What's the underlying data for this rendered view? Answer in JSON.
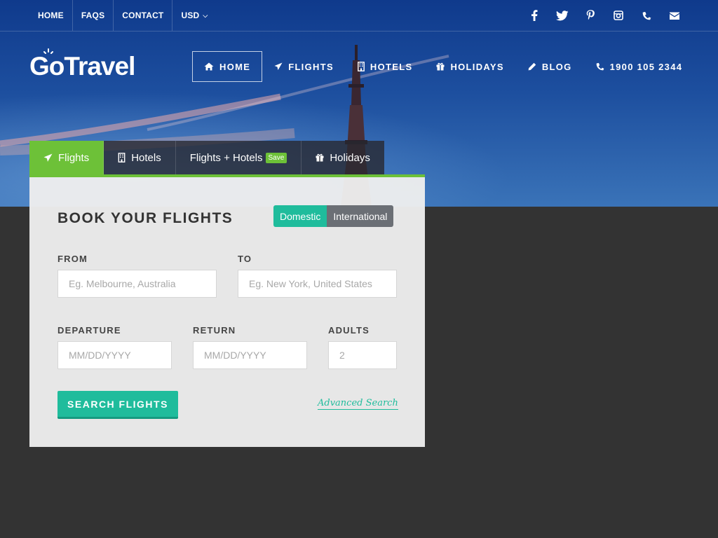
{
  "topbar": {
    "links": [
      "HOME",
      "FAQS",
      "CONTACT"
    ],
    "currency": "USD",
    "social_icons": [
      "facebook-icon",
      "twitter-icon",
      "pinterest-icon",
      "instagram-icon",
      "phone-icon",
      "envelope-icon"
    ]
  },
  "brand": {
    "logo_part1": "Go",
    "logo_part2": "Travel"
  },
  "nav": {
    "home": "HOME",
    "flights": "FLIGHTS",
    "hotels": "HOTELS",
    "holidays": "HOLIDAYS",
    "blog": "BLOG",
    "phone": "1900 105 2344"
  },
  "tabs": {
    "flights": "Flights",
    "hotels": "Hotels",
    "flights_hotels": "Flights + Hotels",
    "save_badge": "Save",
    "holidays": "Holidays"
  },
  "form": {
    "title": "Book Your Flights",
    "toggle": {
      "domestic": "Domestic",
      "international": "International"
    },
    "from_label": "From",
    "from_placeholder": "Eg. Melbourne, Australia",
    "to_label": "To",
    "to_placeholder": "Eg. New York, United States",
    "departure_label": "Departure",
    "departure_placeholder": "MM/DD/YYYY",
    "return_label": "Return",
    "return_placeholder": "MM/DD/YYYY",
    "adults_label": "Adults",
    "adults_placeholder": "2",
    "search_button": "Search Flights",
    "advanced_link": "Advanced Search"
  },
  "colors": {
    "accent_green": "#6dc138",
    "teal": "#1fbc9c",
    "dark_bg": "#333333"
  }
}
